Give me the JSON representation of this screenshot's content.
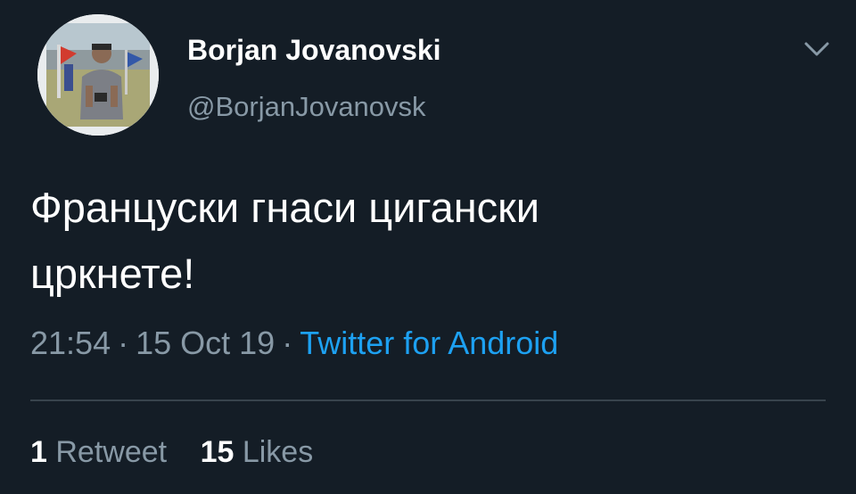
{
  "user": {
    "display_name": "Borjan Jovanovski",
    "handle": "@BorjanJovanovsk",
    "avatar_icon": "profile-photo"
  },
  "menu": {
    "icon": "chevron-down-icon"
  },
  "tweet": {
    "text": "Француски гнаси цигански\nцркнете!",
    "time": "21:54",
    "date": "15 Oct 19",
    "separator": "·",
    "source": "Twitter for Android"
  },
  "stats": {
    "retweets_count": "1",
    "retweets_label": "Retweet",
    "likes_count": "15",
    "likes_label": "Likes"
  },
  "colors": {
    "background": "#141d26",
    "text": "#ffffff",
    "secondary": "#8899a6",
    "link": "#1da1f2",
    "divider": "#38444d"
  }
}
